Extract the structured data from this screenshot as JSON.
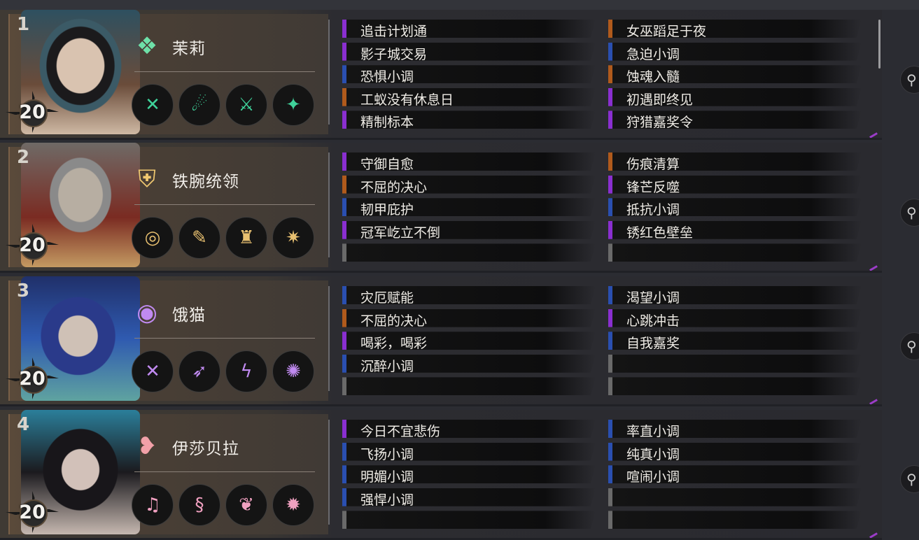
{
  "colors": {
    "purple": "#8a2fd0",
    "orange": "#b05a1c",
    "blue": "#2a4fb0",
    "empty": "#6a6a6a"
  },
  "hunters": [
    {
      "rank": "1",
      "level": "20",
      "name": "茉莉",
      "role_icon": "jade-shard-icon",
      "skill_icons": [
        "crossed-blades-icon",
        "ghost-strike-icon",
        "lunge-icon",
        "green-slash-icon"
      ],
      "traits_left": [
        {
          "label": "追击计划通",
          "color": "purple"
        },
        {
          "label": "影子城交易",
          "color": "purple"
        },
        {
          "label": "恐惧小调",
          "color": "blue"
        },
        {
          "label": "工蚁没有休息日",
          "color": "orange"
        },
        {
          "label": "精制标本",
          "color": "purple"
        }
      ],
      "traits_right": [
        {
          "label": "女巫蹈足于夜",
          "color": "orange"
        },
        {
          "label": "急迫小调",
          "color": "blue"
        },
        {
          "label": "蚀魂入髓",
          "color": "orange"
        },
        {
          "label": "初遇即终见",
          "color": "purple"
        },
        {
          "label": "狩猎嘉奖令",
          "color": "purple"
        }
      ]
    },
    {
      "rank": "2",
      "level": "20",
      "name": "铁腕统领",
      "role_icon": "armor-icon",
      "skill_icons": [
        "clock-icon",
        "scroll-icon",
        "helm-icon",
        "golden-claw-icon"
      ],
      "traits_left": [
        {
          "label": "守御自愈",
          "color": "purple"
        },
        {
          "label": "不屈的决心",
          "color": "orange"
        },
        {
          "label": "韧甲庇护",
          "color": "blue"
        },
        {
          "label": "冠军屹立不倒",
          "color": "purple"
        },
        {
          "label": "",
          "color": "empty"
        }
      ],
      "traits_right": [
        {
          "label": "伤痕清算",
          "color": "orange"
        },
        {
          "label": "锋芒反噬",
          "color": "purple"
        },
        {
          "label": "抵抗小调",
          "color": "blue"
        },
        {
          "label": "锈红色壁垒",
          "color": "purple"
        },
        {
          "label": "",
          "color": "empty"
        }
      ]
    },
    {
      "rank": "3",
      "level": "20",
      "name": "饿猫",
      "role_icon": "eye-icon",
      "skill_icons": [
        "crossed-swords-icon",
        "pounce-icon",
        "strike-icon",
        "purple-burst-icon"
      ],
      "traits_left": [
        {
          "label": "灾厄赋能",
          "color": "blue"
        },
        {
          "label": "不屈的决心",
          "color": "orange"
        },
        {
          "label": "喝彩，喝彩",
          "color": "purple"
        },
        {
          "label": "沉醉小调",
          "color": "blue"
        },
        {
          "label": "",
          "color": "empty"
        }
      ],
      "traits_right": [
        {
          "label": "渴望小调",
          "color": "blue"
        },
        {
          "label": "心跳冲击",
          "color": "purple"
        },
        {
          "label": "自我嘉奖",
          "color": "blue"
        },
        {
          "label": "",
          "color": "empty"
        },
        {
          "label": "",
          "color": "empty"
        }
      ]
    },
    {
      "rank": "4",
      "level": "20",
      "name": "伊莎贝拉",
      "role_icon": "lips-icon",
      "skill_icons": [
        "lyre-icon",
        "serpent-icon",
        "dancer-icon",
        "pink-burst-icon"
      ],
      "traits_left": [
        {
          "label": "今日不宜悲伤",
          "color": "purple"
        },
        {
          "label": "飞扬小调",
          "color": "blue"
        },
        {
          "label": "明媚小调",
          "color": "blue"
        },
        {
          "label": "强悍小调",
          "color": "blue"
        },
        {
          "label": "",
          "color": "empty"
        }
      ],
      "traits_right": [
        {
          "label": "率直小调",
          "color": "blue"
        },
        {
          "label": "纯真小调",
          "color": "blue"
        },
        {
          "label": "喧闹小调",
          "color": "blue"
        },
        {
          "label": "",
          "color": "empty"
        },
        {
          "label": "",
          "color": "empty"
        }
      ]
    }
  ]
}
